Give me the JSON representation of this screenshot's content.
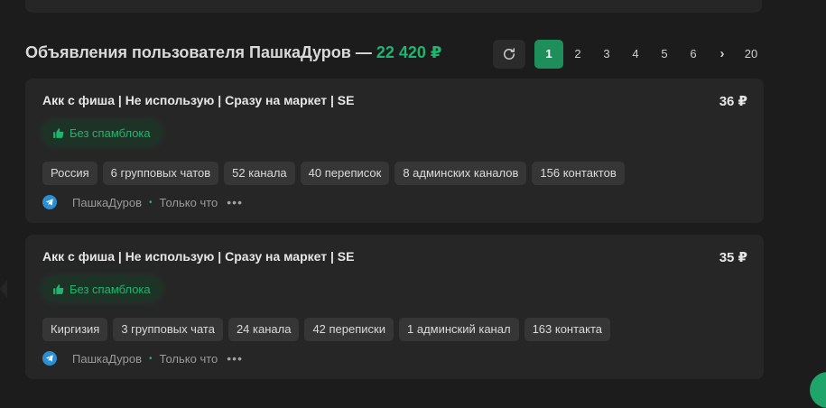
{
  "header": {
    "title": "Объявления пользователя ПашкаДуров —",
    "total": "22 420 ₽",
    "refresh_icon": "refresh-icon"
  },
  "pagination": {
    "pages": [
      "1",
      "2",
      "3",
      "4",
      "5",
      "6"
    ],
    "next": "›",
    "last": "20",
    "active": "1"
  },
  "colors": {
    "accent": "#1fb56f",
    "active_page": "#1e8f5b",
    "card": "#262626",
    "tag": "#363636",
    "telegram": "#2b8fd4"
  },
  "listings": [
    {
      "title": "Акк с фиша | Не использую | Сразу на маркет | SE",
      "price": "36 ₽",
      "badge": "Без спамблока",
      "tags": [
        "Россия",
        "6 групповых чатов",
        "52 канала",
        "40 переписок",
        "8 админских каналов",
        "156 контактов"
      ],
      "seller": "ПашкаДуров",
      "time": "Только что"
    },
    {
      "title": "Акк с фиша | Не использую | Сразу на маркет | SE",
      "price": "35 ₽",
      "badge": "Без спамблока",
      "tags": [
        "Киргизия",
        "3 групповых чата",
        "24 канала",
        "42 переписки",
        "1 админский канал",
        "163 контакта"
      ],
      "seller": "ПашкаДуров",
      "time": "Только что"
    }
  ]
}
